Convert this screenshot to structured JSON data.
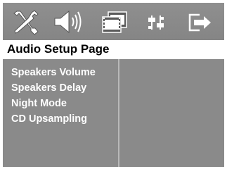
{
  "toolbar": {
    "icons": [
      "tools-icon",
      "speaker-icon",
      "film-icon",
      "preferences-icon",
      "exit-icon"
    ],
    "selected": "speaker-icon"
  },
  "header": {
    "title": "Audio Setup Page"
  },
  "menu": {
    "items": [
      {
        "label": "Speakers Volume"
      },
      {
        "label": "Speakers Delay"
      },
      {
        "label": "Night Mode"
      },
      {
        "label": "CD Upsampling"
      }
    ]
  },
  "colors": {
    "background": "#8a8a8a",
    "header_background": "#ffffff",
    "menu_text": "#ffffff",
    "divider": "#b9b9b9"
  }
}
